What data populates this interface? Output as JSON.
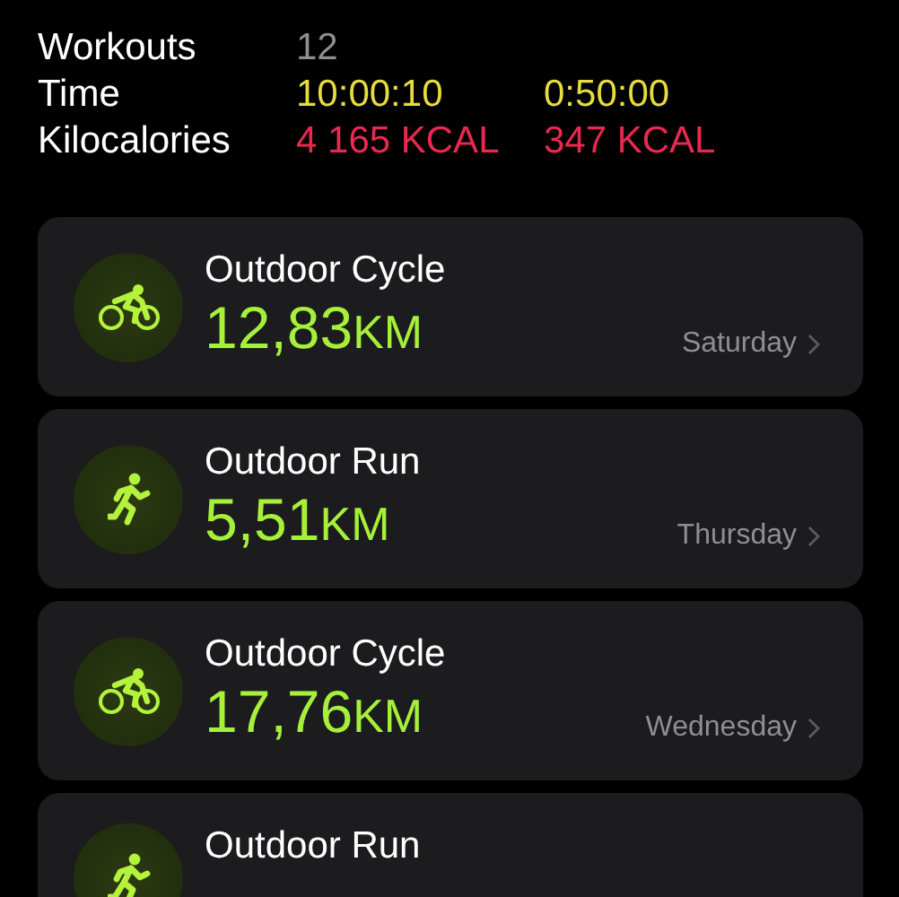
{
  "summary": [
    {
      "label": "Workouts",
      "total": "12",
      "kind": "count"
    },
    {
      "label": "Time",
      "total": "10:00:10",
      "kind": "time",
      "average": "0:50:00"
    },
    {
      "label": "Kilocalories",
      "total": "4 165 KCAL",
      "kind": "energy",
      "average": "347 KCAL"
    }
  ],
  "workouts": [
    {
      "kind": "cycle",
      "title": "Outdoor Cycle",
      "distance": "12,83",
      "unit": "KM",
      "day": "Saturday"
    },
    {
      "kind": "run",
      "title": "Outdoor Run",
      "distance": "5,51",
      "unit": "KM",
      "day": "Thursday"
    },
    {
      "kind": "cycle",
      "title": "Outdoor Cycle",
      "distance": "17,76",
      "unit": "KM",
      "day": "Wednesday"
    },
    {
      "kind": "run",
      "title": "Outdoor Run"
    }
  ]
}
